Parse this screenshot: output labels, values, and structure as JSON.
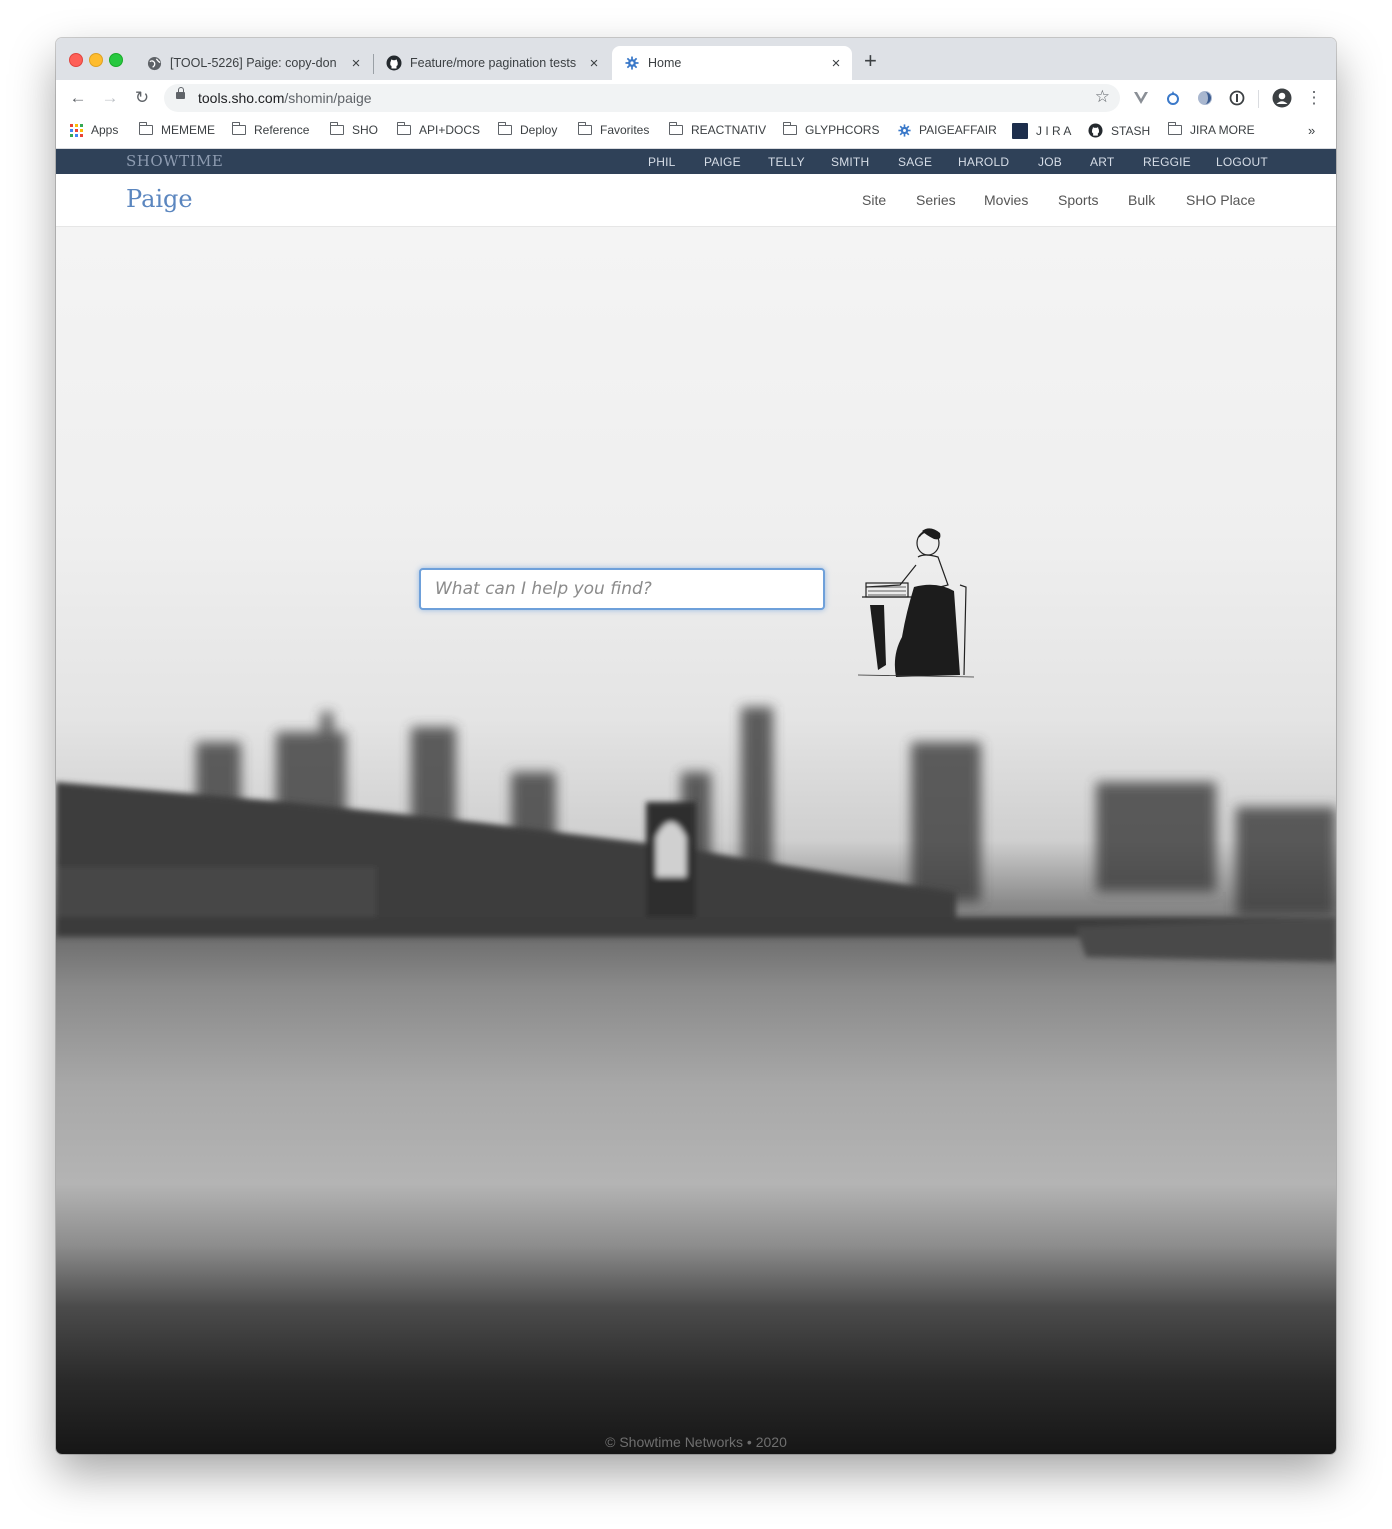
{
  "browser": {
    "tabs": [
      {
        "title": "[TOOL-5226] Paige: copy-don",
        "icon": "globe-icon",
        "active": false
      },
      {
        "title": "Feature/more pagination tests",
        "icon": "github-icon",
        "active": false
      },
      {
        "title": "Home",
        "icon": "gear-icon",
        "active": true
      }
    ],
    "close_glyph": "×",
    "new_tab_glyph": "+",
    "url_host": "tools.sho.com",
    "url_path": "/shomin/paige",
    "bookmarks": [
      {
        "label": "Apps",
        "icon": "apps-grid-icon"
      },
      {
        "label": "MEMEME",
        "icon": "folder-icon"
      },
      {
        "label": "Reference",
        "icon": "folder-icon"
      },
      {
        "label": "SHO",
        "icon": "folder-icon"
      },
      {
        "label": "API+DOCS",
        "icon": "folder-icon"
      },
      {
        "label": "Deploy",
        "icon": "folder-icon"
      },
      {
        "label": "Favorites",
        "icon": "folder-icon"
      },
      {
        "label": "REACTNATIV",
        "icon": "folder-icon"
      },
      {
        "label": "GLYPHCORS",
        "icon": "folder-icon"
      },
      {
        "label": "PAIGEAFFAIR",
        "icon": "gear-icon"
      },
      {
        "label": "J I R A",
        "icon": "sho-badge-icon"
      },
      {
        "label": "STASH",
        "icon": "github-icon"
      },
      {
        "label": "JIRA MORE",
        "icon": "folder-icon"
      }
    ],
    "bookmarks_overflow": "»"
  },
  "site": {
    "brand_logo": "SHOWTIME",
    "top_nav": [
      "PHIL",
      "PAIGE",
      "TELLY",
      "SMITH",
      "SAGE",
      "HAROLD",
      "JOB",
      "ART",
      "REGGIE",
      "LOGOUT"
    ],
    "app_name": "Paige",
    "sub_nav": [
      "Site",
      "Series",
      "Movies",
      "Sports",
      "Bulk",
      "SHO Place"
    ],
    "search_placeholder": "What can I help you find?",
    "footer": "© Showtime Networks • 2020"
  },
  "colors": {
    "nav_bar": "#2f4158",
    "brand_blue": "#5b86bf",
    "search_focus": "#6ea0da"
  }
}
